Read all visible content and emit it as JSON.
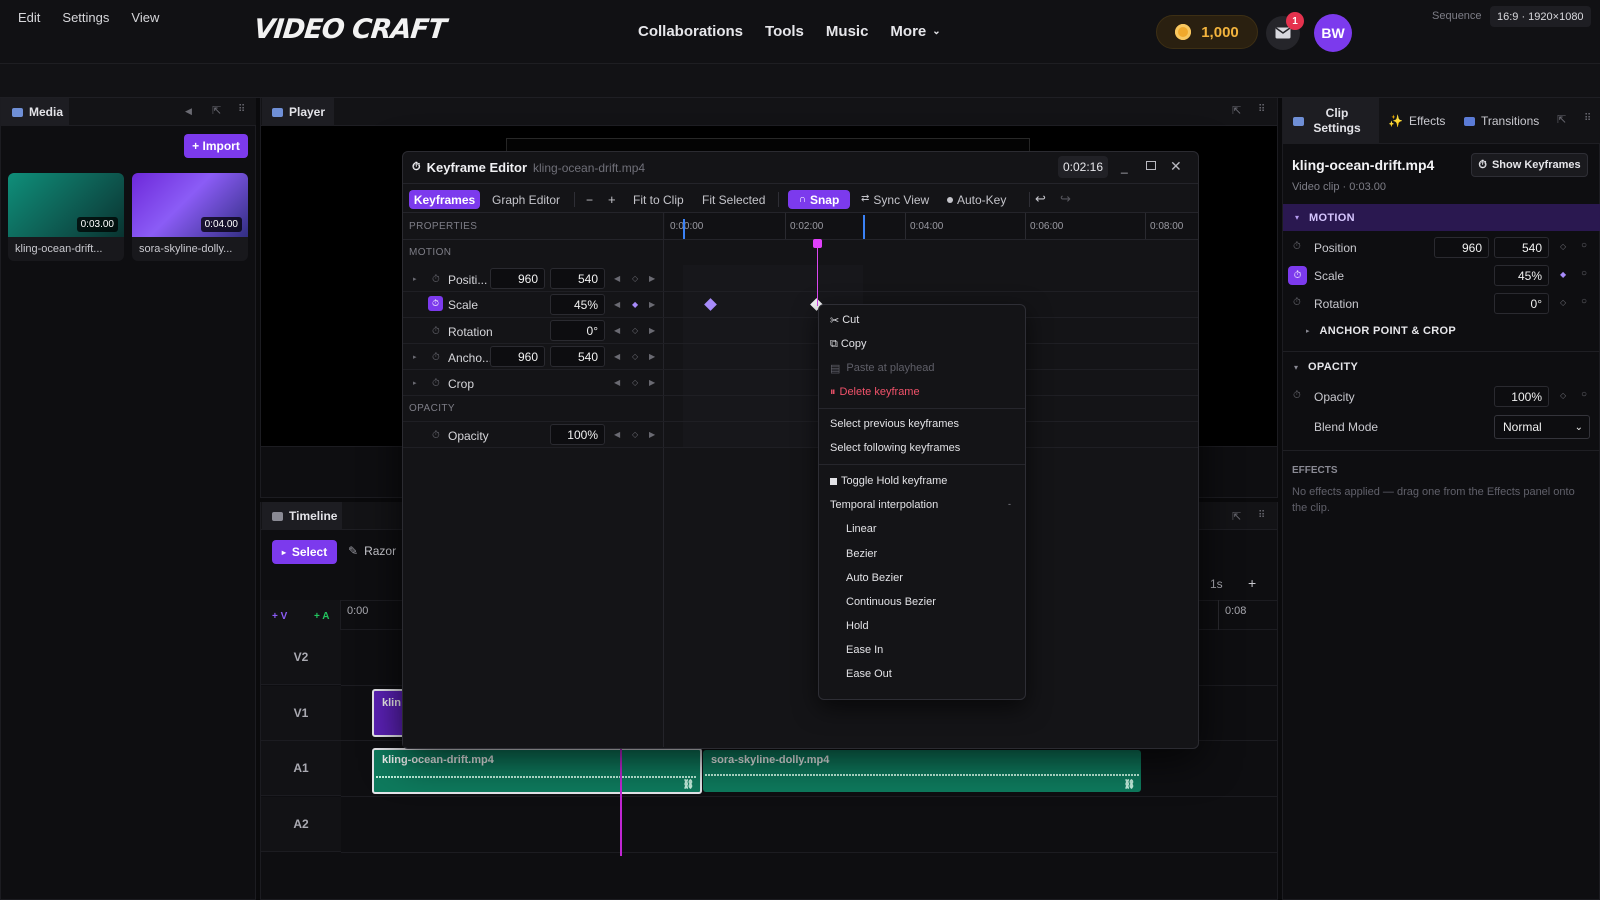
{
  "app": {
    "logo": "VIDEO CRAFT"
  },
  "nav": {
    "links": [
      "Collaborations",
      "Tools",
      "Music",
      "More"
    ]
  },
  "user": {
    "coins": "1,000",
    "notifications": "1",
    "initials": "BW"
  },
  "menubar": {
    "items": [
      "Edit",
      "Settings",
      "View"
    ],
    "sequence_label": "Sequence",
    "sequence_value": "16:9 · 1920×1080"
  },
  "media": {
    "tab": "Media",
    "import": "+ Import",
    "clips": [
      {
        "name": "kling-ocean-drift...",
        "duration": "0:03.00"
      },
      {
        "name": "sora-skyline-dolly...",
        "duration": "0:04.00"
      }
    ]
  },
  "player": {
    "tab": "Player"
  },
  "keyframe_editor": {
    "title": "Keyframe Editor",
    "file": "kling-ocean-drift.mp4",
    "time": "0:02:16",
    "toolbar": {
      "keyframes": "Keyframes",
      "graph": "Graph Editor",
      "minus": "−",
      "plus": "+",
      "fit_clip": "Fit to Clip",
      "fit_sel": "Fit Selected",
      "snap": "Snap",
      "sync": "Sync View",
      "autokey": "Auto-Key"
    },
    "properties_header": "PROPERTIES",
    "ruler": [
      "0:00:00",
      "0:02:00",
      "0:04:00",
      "0:06:00",
      "0:08:00"
    ],
    "sections": {
      "motion": "MOTION",
      "opacity": "OPACITY"
    },
    "props": {
      "position": {
        "label": "Positi...",
        "x": "960",
        "y": "540"
      },
      "scale": {
        "label": "Scale",
        "value": "45%"
      },
      "rotation": {
        "label": "Rotation",
        "value": "0°"
      },
      "anchor": {
        "label": "Ancho...",
        "x": "960",
        "y": "540"
      },
      "crop": {
        "label": "Crop"
      },
      "opacity": {
        "label": "Opacity",
        "value": "100%"
      }
    }
  },
  "context_menu": {
    "cut": "Cut",
    "copy": "Copy",
    "paste": "Paste at playhead",
    "delete": "Delete keyframe",
    "select_prev": "Select previous keyframes",
    "select_next": "Select following keyframes",
    "toggle_hold": "Toggle Hold keyframe",
    "temporal": "Temporal interpolation",
    "interp": [
      "Linear",
      "Bezier",
      "Auto Bezier",
      "Continuous Bezier",
      "Hold",
      "Ease In",
      "Ease Out"
    ]
  },
  "timeline": {
    "tab": "Timeline",
    "select": "Select",
    "razor": "Razor",
    "zoom": "1s",
    "add_v": "+ V",
    "add_a": "+ A",
    "ruler_start": "0:00",
    "ruler_end": "0:08",
    "tracks": [
      "V2",
      "V1",
      "A1",
      "A2"
    ],
    "clips": {
      "v1": "klin",
      "a1_first": "kling-ocean-drift.mp4",
      "a1_second": "sora-skyline-dolly.mp4"
    }
  },
  "clip_settings": {
    "tabs": [
      "Clip Settings",
      "Effects",
      "Transitions"
    ],
    "clip_name": "kling-ocean-drift.mp4",
    "clip_meta": "Video clip · 0:03.00",
    "show_keyframes": "Show Keyframes",
    "motion": "MOTION",
    "position_label": "Position",
    "position_x": "960",
    "position_y": "540",
    "scale_label": "Scale",
    "scale": "45%",
    "rotation_label": "Rotation",
    "rotation": "0°",
    "anchor": "ANCHOR POINT & CROP",
    "opacity_section": "OPACITY",
    "opacity_label": "Opacity",
    "opacity": "100%",
    "blend_label": "Blend Mode",
    "blend": "Normal",
    "effects_header": "EFFECTS",
    "effects_empty": "No effects applied — drag one from the Effects panel onto the clip."
  },
  "colors": {
    "accent": "#7c3aed",
    "playhead": "#d946ef",
    "audio_clip": "#0e7a5d",
    "coin": "#f2b33d"
  }
}
